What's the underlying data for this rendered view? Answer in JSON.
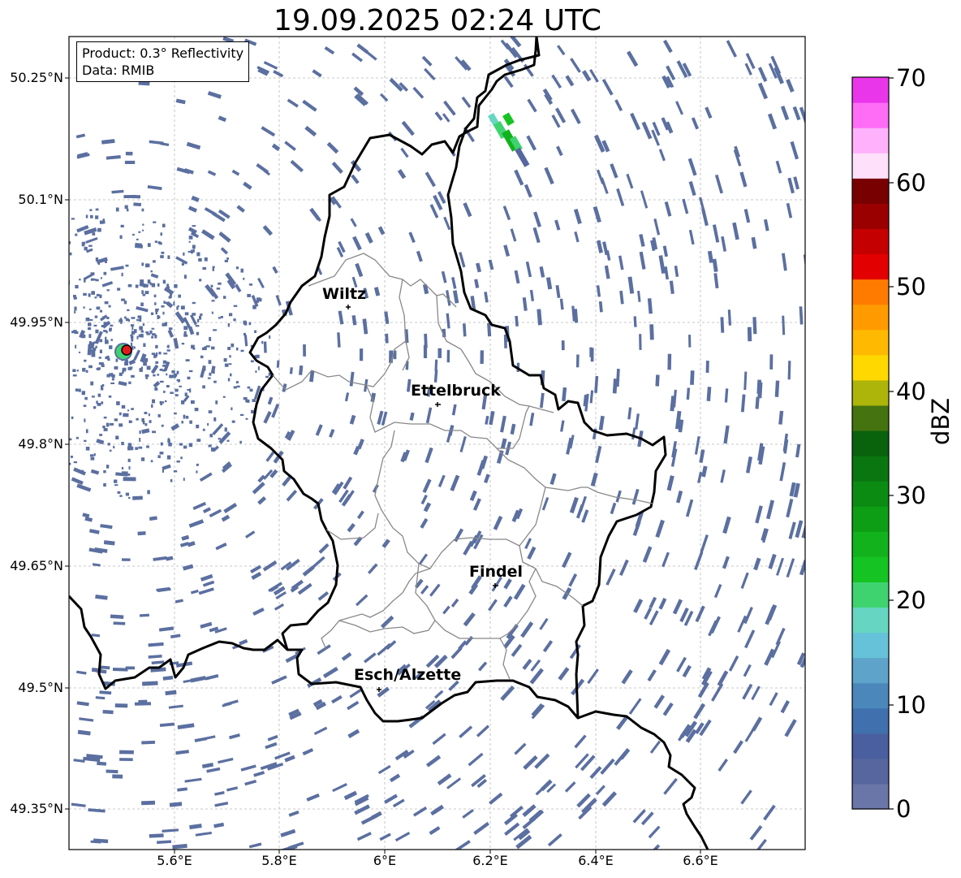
{
  "title": "19.09.2025 02:24 UTC",
  "info_box": {
    "product": "Product: 0.3° Reflectivity",
    "data_source": "Data: RMIB"
  },
  "map": {
    "lat_ticks": [
      "50.25°N",
      "50.1°N",
      "49.95°N",
      "49.8°N",
      "49.65°N",
      "49.5°N",
      "49.35°N"
    ],
    "lon_ticks": [
      "5.6°E",
      "5.8°E",
      "6°E",
      "6.2°E",
      "6.4°E",
      "6.6°E"
    ],
    "cities": [
      "Wiltz",
      "Ettelbruck",
      "Findel",
      "Esch/Alzette"
    ],
    "radar_site_color": "#e31a1c",
    "echo_color": "#5b6fa0"
  },
  "colorbar": {
    "label": "dBZ",
    "ticks": [
      "0",
      "10",
      "20",
      "30",
      "40",
      "50",
      "60",
      "70"
    ],
    "colors": [
      "#6a76a8",
      "#57669e",
      "#4a5fa0",
      "#4070ad",
      "#4b87bb",
      "#5ea3c9",
      "#66c2d8",
      "#66d6c2",
      "#3fd370",
      "#15c422",
      "#12b21c",
      "#0e9e15",
      "#0b8b12",
      "#0a760f",
      "#09620c",
      "#44730f",
      "#adb40a",
      "#ffd800",
      "#ffb900",
      "#ff9b00",
      "#ff7b00",
      "#e30000",
      "#c50000",
      "#9b0000",
      "#780000",
      "#ffe0fb",
      "#ffb2fb",
      "#ff6cf5",
      "#ea36ea"
    ]
  }
}
